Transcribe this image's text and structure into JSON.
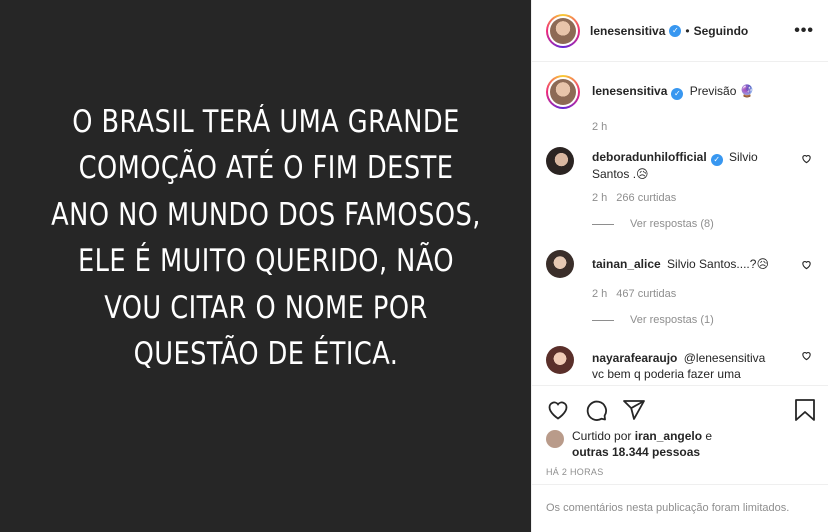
{
  "media": {
    "text": "O BRASIL TERÁ UMA GRANDE COMOÇÃO ATÉ O FIM DESTE ANO NO MUNDO DOS FAMOSOS, ELE É MUITO QUERIDO, NÃO VOU CITAR O NOME POR QUESTÃO DE ÉTICA."
  },
  "header": {
    "username": "lenesensitiva",
    "separator": "•",
    "follow_label": "Seguindo",
    "more_label": "•••"
  },
  "caption": {
    "username": "lenesensitiva",
    "text": "Previsão",
    "emoji": "🔮",
    "time": "2 h"
  },
  "comments": [
    {
      "username": "deboradunhilofficial",
      "verified": true,
      "text": "Silvio Santos .",
      "emoji": "😥",
      "time": "2 h",
      "likes": "266 curtidas",
      "replies": "Ver respostas (8)"
    },
    {
      "username": "tainan_alice",
      "verified": false,
      "text": "Silvio Santos....?",
      "emoji": "😥",
      "time": "2 h",
      "likes": "467 curtidas",
      "replies": "Ver respostas (1)"
    },
    {
      "username": "nayarafearaujo",
      "verified": false,
      "text": "@lenesensitiva vc bem q poderia fazer uma",
      "time": "",
      "likes": "",
      "replies": ""
    }
  ],
  "likes": {
    "prefix": "Curtido por",
    "user": "iran_angelo",
    "connector": "e",
    "others": "outras 18.344 pessoas"
  },
  "posted": "HÁ 2 HORAS",
  "limited_notice": "Os comentários nesta publicação foram limitados.",
  "colors": {
    "media_bg": "#262626",
    "verified": "#3897f0",
    "muted": "#8e8e8e"
  }
}
